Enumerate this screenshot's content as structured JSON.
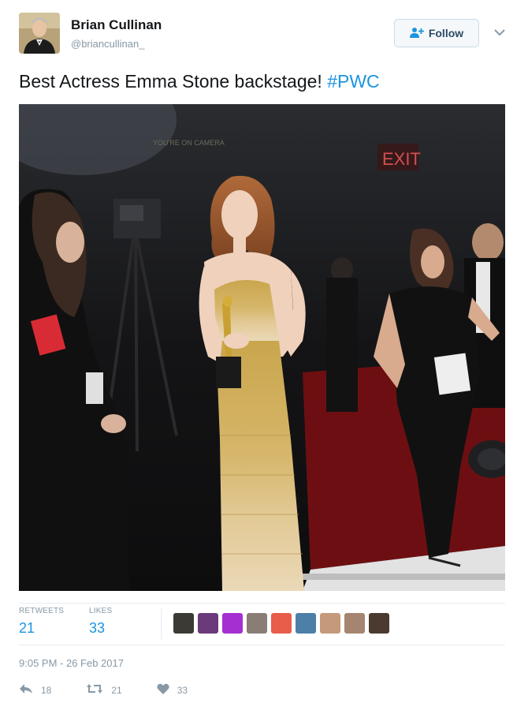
{
  "user": {
    "name": "Brian Cullinan",
    "handle": "@briancullinan_"
  },
  "follow_label": "Follow",
  "tweet": {
    "text": "Best Actress Emma Stone backstage! ",
    "hashtag": "#PWC"
  },
  "photo": {
    "signs": [
      "YOU'RE ON CAMERA",
      "EXIT"
    ]
  },
  "stats": {
    "retweets_label": "RETWEETS",
    "retweets_value": "21",
    "likes_label": "LIKES",
    "likes_value": "33"
  },
  "timestamp": "9:05 PM - 26 Feb 2017",
  "actions": {
    "reply_count": "18",
    "retweet_count": "21",
    "like_count": "33"
  },
  "colors": {
    "link_blue": "#1b95e0",
    "muted_gray": "#8899a6",
    "follow_border": "#c9dbe8",
    "photo_background": "#1a1a1a",
    "red_carpet": "#7a1010"
  },
  "icons": [
    "follow-person-plus-icon",
    "chevron-down-icon",
    "reply-icon",
    "retweet-icon",
    "heart-icon"
  ]
}
